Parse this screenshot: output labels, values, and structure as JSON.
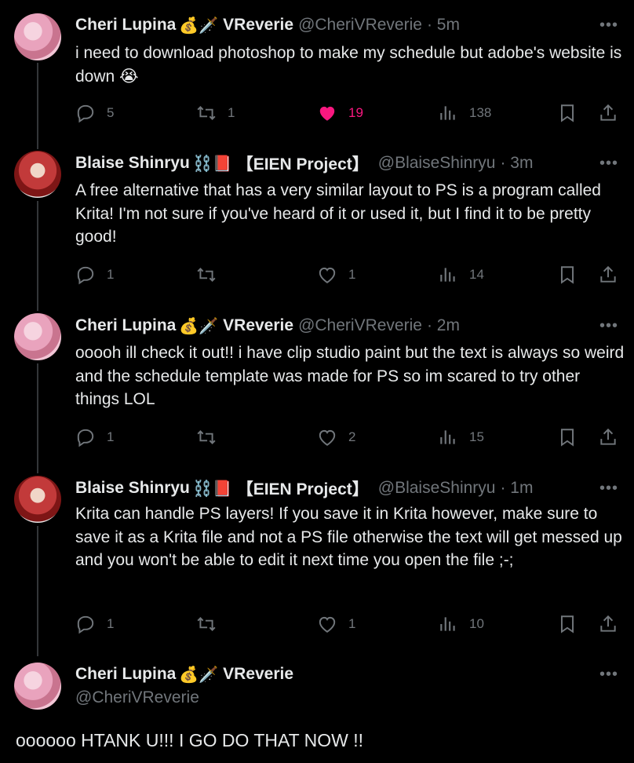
{
  "tweets": [
    {
      "name": "Cheri Lupina",
      "emojis": "💰🗡️",
      "suffix": "VReverie",
      "handle": "@CheriVReverie",
      "time": "· 5m",
      "text": "i need to download photoshop to make my schedule but adobe's website is down 😭",
      "replies": "5",
      "retweets": "1",
      "likes": "19",
      "views": "138",
      "liked": true
    },
    {
      "name": "Blaise Shinryu",
      "emojis": "⛓️📕",
      "suffix": "【EIEN Project】",
      "handle": "@BlaiseShinryu",
      "time": "· 3m",
      "text": "A free alternative that has a very similar layout to PS is a program called Krita! I'm not sure if you've heard of it or used it, but I find it to be pretty good!",
      "replies": "1",
      "retweets": "",
      "likes": "1",
      "views": "14",
      "liked": false
    },
    {
      "name": "Cheri Lupina",
      "emojis": "💰🗡️",
      "suffix": "VReverie",
      "handle": "@CheriVReverie",
      "time": "· 2m",
      "text": "ooooh ill check it out!! i have clip studio paint but the text is always so weird and the schedule template was made for PS so im scared to try other things LOL",
      "replies": "1",
      "retweets": "",
      "likes": "2",
      "views": "15",
      "liked": false
    },
    {
      "name": "Blaise Shinryu",
      "emojis": "⛓️📕",
      "suffix": "【EIEN Project】",
      "handle": "@BlaiseShinryu",
      "time": "· 1m",
      "text": "Krita can handle PS layers! If you save it in Krita however, make sure to save it as a Krita file and not a PS file otherwise the text will get messed up and you won't be able to edit it next time you open the file ;-;",
      "replies": "1",
      "retweets": "",
      "likes": "1",
      "views": "10",
      "liked": false
    }
  ],
  "focused": {
    "name": "Cheri Lupina",
    "emojis": "💰🗡️",
    "suffix": "VReverie",
    "handle": "@CheriVReverie",
    "text": "oooooo HTANK U!!! I GO DO THAT NOW !!"
  },
  "more_glyph": "•••",
  "colors": {
    "background": "#000000",
    "text": "#e7e9ea",
    "muted": "#71767b",
    "like": "#f91880",
    "thread_line": "#333639"
  },
  "icons": [
    "reply-icon",
    "retweet-icon",
    "like-icon",
    "views-icon",
    "bookmark-icon",
    "share-icon",
    "more-icon"
  ]
}
